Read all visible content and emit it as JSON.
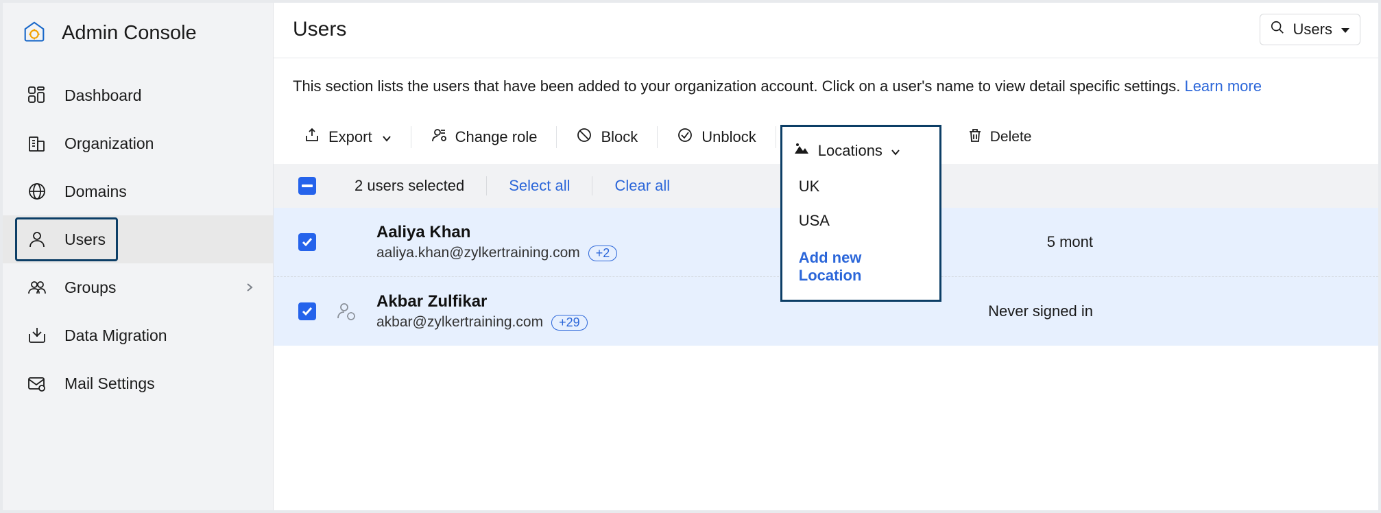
{
  "sidebar": {
    "title": "Admin Console",
    "items": [
      {
        "label": "Dashboard"
      },
      {
        "label": "Organization"
      },
      {
        "label": "Domains"
      },
      {
        "label": "Users"
      },
      {
        "label": "Groups"
      },
      {
        "label": "Data Migration"
      },
      {
        "label": "Mail Settings"
      }
    ]
  },
  "header": {
    "title": "Users",
    "search_scope": "Users"
  },
  "description": {
    "text": "This section lists the users that have been added to your organization account. Click on a user's name to view detail specific settings. ",
    "learn_more": "Learn more"
  },
  "toolbar": {
    "export": "Export",
    "change_role": "Change role",
    "block": "Block",
    "unblock": "Unblock",
    "locations": "Locations",
    "delete": "Delete"
  },
  "locations_menu": {
    "items": [
      "UK",
      "USA"
    ],
    "add_new": "Add new Location"
  },
  "selection": {
    "count_text": "2 users selected",
    "select_all": "Select all",
    "clear_all": "Clear all"
  },
  "users": [
    {
      "name": "Aaliya Khan",
      "email": "aaliya.khan@zylkertraining.com",
      "alias_count": "+2",
      "meta": "5 mont",
      "has_icon": false
    },
    {
      "name": "Akbar Zulfikar",
      "email": "akbar@zylkertraining.com",
      "alias_count": "+29",
      "meta": "Never signed in",
      "has_icon": true
    }
  ]
}
